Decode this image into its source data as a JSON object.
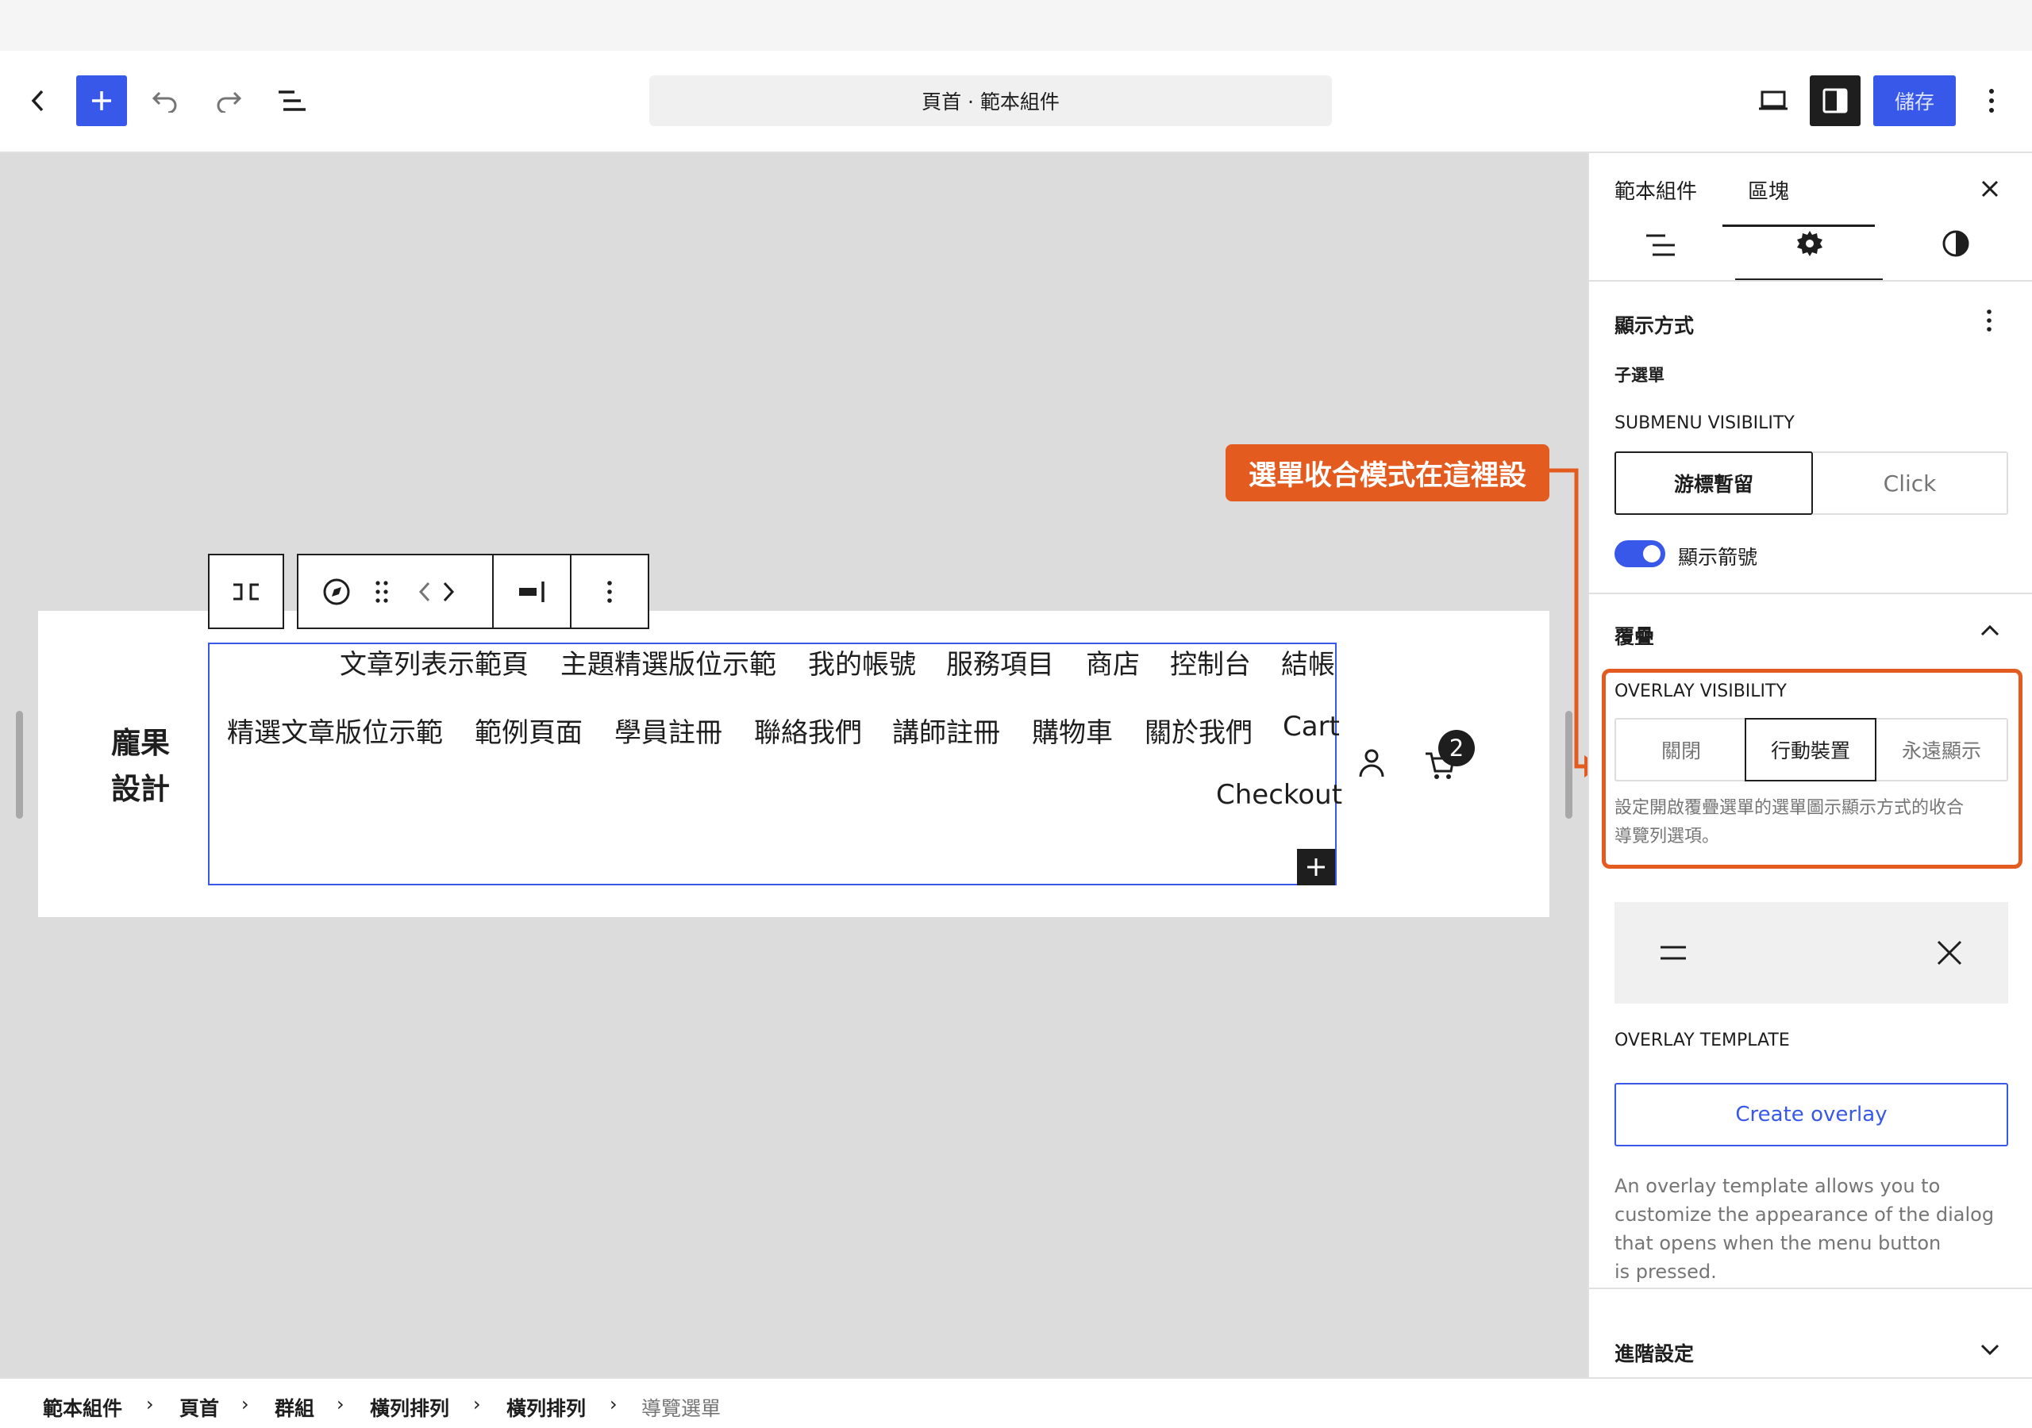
{
  "header": {
    "document_title": "頁首 · 範本組件",
    "save_label": "儲存"
  },
  "canvas": {
    "site_title_line1": "龐果",
    "site_title_line2": "設計",
    "nav_row1": [
      "文章列表示範頁",
      "主題精選版位示範",
      "我的帳號",
      "服務項目",
      "商店",
      "控制台",
      "結帳"
    ],
    "nav_row2": [
      "精選文章版位示範",
      "範例頁面",
      "學員註冊",
      "聯絡我們",
      "講師註冊",
      "購物車",
      "關於我們",
      "Cart"
    ],
    "nav_row3": [
      "Checkout"
    ],
    "cart_count": "2"
  },
  "callout": {
    "text": "選單收合模式在這裡設"
  },
  "sidebar": {
    "tabs": [
      "範本組件",
      "區塊"
    ],
    "display_section": {
      "title": "顯示方式",
      "submenu_label": "子選單",
      "submenu_visibility_label": "SUBMENU VISIBILITY",
      "submenu_options": [
        "游標暫留",
        "Click"
      ],
      "show_arrow_label": "顯示箭號"
    },
    "overlay_section": {
      "title": "覆疊",
      "visibility_label": "OVERLAY VISIBILITY",
      "visibility_options": [
        "關閉",
        "行動裝置",
        "永遠顯示"
      ],
      "help_line1": "設定開啟覆疊選單的選單圖示顯示方式的收合",
      "help_line2": "導覽列選項。",
      "template_label": "OVERLAY TEMPLATE",
      "create_button": "Create overlay",
      "template_help": [
        "An overlay template allows you to",
        "customize the appearance of the dialog",
        "that opens when the menu button",
        "is pressed."
      ]
    },
    "advanced_title": "進階設定"
  },
  "breadcrumb": {
    "items": [
      "範本組件",
      "頁首",
      "群組",
      "橫列排列",
      "橫列排列"
    ],
    "current": "導覽選單"
  },
  "colors": {
    "accent": "#3858e9",
    "callout": "#e45b1f",
    "dark": "#1e1e1e"
  }
}
